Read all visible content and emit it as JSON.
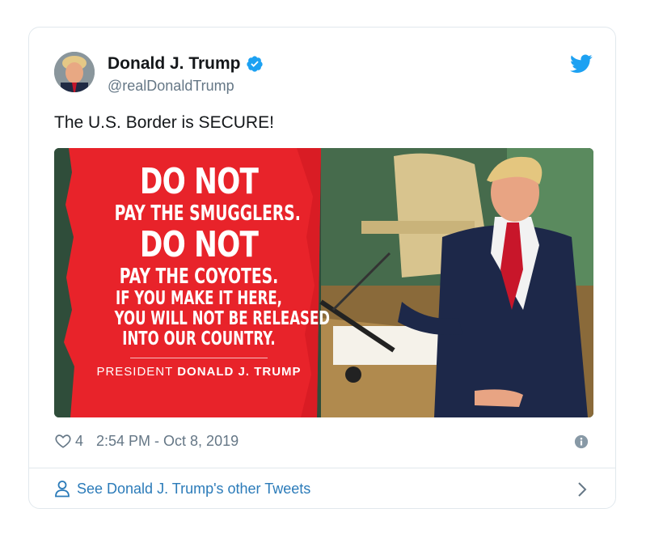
{
  "author": {
    "name": "Donald J. Trump",
    "handle": "@realDonaldTrump",
    "verified": true
  },
  "tweet": {
    "text": "The U.S. Border is SECURE!"
  },
  "media": {
    "lines": {
      "line1": "DO NOT",
      "line2": "PAY THE SMUGGLERS.",
      "line3": "DO NOT",
      "line4": "PAY THE COYOTES.",
      "line5": "IF YOU MAKE IT HERE,",
      "line6": "YOU WILL NOT BE RELEASED",
      "line7": "INTO OUR COUNTRY."
    },
    "signature_prefix": "PRESIDENT",
    "signature_name": "DONALD J. TRUMP",
    "banner_color": "#e8232a"
  },
  "meta": {
    "likes": "4",
    "timestamp": "2:54 PM - Oct 8, 2019"
  },
  "footer": {
    "link_text": "See Donald J. Trump's other Tweets"
  },
  "colors": {
    "twitter_blue": "#1da1f2",
    "link": "#2b7bb9",
    "secondary_text": "#657786"
  },
  "icons": [
    "twitter-bird-icon",
    "verified-badge-icon",
    "heart-icon",
    "info-icon",
    "person-icon",
    "chevron-right-icon"
  ]
}
